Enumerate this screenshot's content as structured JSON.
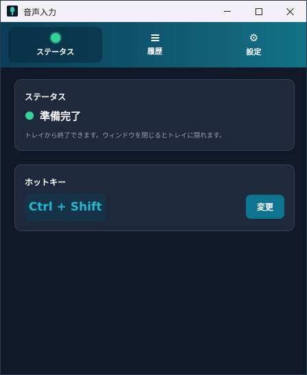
{
  "window": {
    "title": "音声入力"
  },
  "nav": {
    "tabs": [
      {
        "label": "ステータス",
        "icon": "status-dot-icon",
        "active": true
      },
      {
        "label": "履歴",
        "icon": "menu-icon",
        "active": false
      },
      {
        "label": "設定",
        "icon": "gear-icon",
        "active": false
      }
    ]
  },
  "status_card": {
    "title": "ステータス",
    "state": "準備完了",
    "hint": "トレイから終了できます。ウィンドウを閉じるとトレイに隠れます。"
  },
  "hotkey_card": {
    "title": "ホットキー",
    "value": "Ctrl + Shift",
    "change_label": "変更"
  },
  "colors": {
    "accent": "#0e7490",
    "status_ready": "#34d399",
    "background": "#111827",
    "card": "#1e293b"
  }
}
